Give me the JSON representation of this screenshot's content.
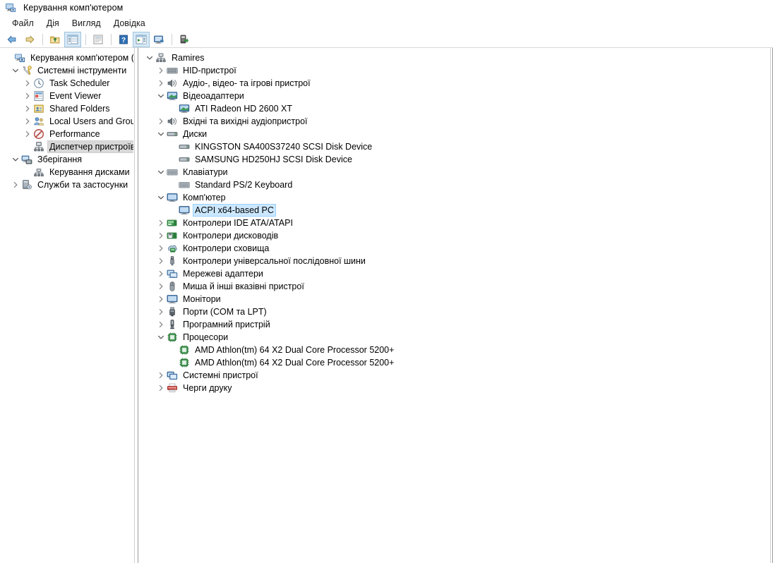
{
  "window": {
    "title": "Керування комп'ютером",
    "icon": "computer-management-icon"
  },
  "menubar": {
    "items": [
      {
        "label": "Файл",
        "name": "menu-file"
      },
      {
        "label": "Дія",
        "name": "menu-action"
      },
      {
        "label": "Вигляд",
        "name": "menu-view"
      },
      {
        "label": "Довідка",
        "name": "menu-help"
      }
    ]
  },
  "toolbar": {
    "buttons": [
      {
        "name": "back-button",
        "icon": "arrow-left-icon",
        "pressed": false
      },
      {
        "name": "forward-button",
        "icon": "arrow-right-icon",
        "pressed": false
      },
      {
        "name": "up-one-level-button",
        "icon": "folder-up-icon",
        "pressed": false
      },
      {
        "name": "show-hide-console-tree-button",
        "icon": "console-tree-icon",
        "pressed": true
      },
      {
        "name": "properties-button",
        "icon": "properties-icon",
        "pressed": false
      },
      {
        "name": "help-button",
        "icon": "question-mark-icon",
        "pressed": false
      },
      {
        "name": "show-hide-action-pane-button",
        "icon": "action-pane-icon",
        "pressed": true
      },
      {
        "name": "scan-for-hardware-changes-button",
        "icon": "monitor-scan-icon",
        "pressed": false
      },
      {
        "name": "add-legacy-hardware-button",
        "icon": "add-hardware-icon",
        "pressed": false
      }
    ]
  },
  "left_tree": {
    "nodes": [
      {
        "label": "Керування комп'ютером (лок",
        "indent": 0,
        "twist": "none",
        "icon": "computer-management-icon",
        "selected": "none"
      },
      {
        "label": "Системні інструменти",
        "indent": 1,
        "twist": "expanded",
        "icon": "system-tools-icon",
        "selected": "none"
      },
      {
        "label": "Task Scheduler",
        "indent": 2,
        "twist": "collapsed",
        "icon": "clock-icon",
        "selected": "none"
      },
      {
        "label": "Event Viewer",
        "indent": 2,
        "twist": "collapsed",
        "icon": "event-viewer-icon",
        "selected": "none"
      },
      {
        "label": "Shared Folders",
        "indent": 2,
        "twist": "collapsed",
        "icon": "shared-folders-icon",
        "selected": "none"
      },
      {
        "label": "Local Users and Groups",
        "indent": 2,
        "twist": "collapsed",
        "icon": "users-groups-icon",
        "selected": "none"
      },
      {
        "label": "Performance",
        "indent": 2,
        "twist": "collapsed",
        "icon": "performance-icon",
        "selected": "none"
      },
      {
        "label": "Диспетчер пристроїв",
        "indent": 2,
        "twist": "none",
        "icon": "device-manager-icon",
        "selected": "inactive"
      },
      {
        "label": "Зберігання",
        "indent": 1,
        "twist": "expanded",
        "icon": "storage-icon",
        "selected": "none"
      },
      {
        "label": "Керування дисками",
        "indent": 2,
        "twist": "none",
        "icon": "disk-management-icon",
        "selected": "none"
      },
      {
        "label": "Служби та застосунки",
        "indent": 1,
        "twist": "collapsed",
        "icon": "services-apps-icon",
        "selected": "none"
      }
    ]
  },
  "device_tree": {
    "nodes": [
      {
        "label": "Ramires",
        "indent": 0,
        "twist": "expanded",
        "icon": "computer-node-icon",
        "selected": "none"
      },
      {
        "label": "HID-пристрої",
        "indent": 1,
        "twist": "collapsed",
        "icon": "hid-icon",
        "selected": "none"
      },
      {
        "label": "Аудіо-, відео- та ігрові пристрої",
        "indent": 1,
        "twist": "collapsed",
        "icon": "speaker-icon",
        "selected": "none"
      },
      {
        "label": "Відеоадаптери",
        "indent": 1,
        "twist": "expanded",
        "icon": "display-adapter-icon",
        "selected": "none"
      },
      {
        "label": "ATI Radeon HD 2600 XT",
        "indent": 2,
        "twist": "none",
        "icon": "display-adapter-icon",
        "selected": "none"
      },
      {
        "label": "Вхідні та вихідні аудіопристрої",
        "indent": 1,
        "twist": "collapsed",
        "icon": "speaker-icon",
        "selected": "none"
      },
      {
        "label": "Диски",
        "indent": 1,
        "twist": "expanded",
        "icon": "disk-drive-icon",
        "selected": "none"
      },
      {
        "label": "KINGSTON  SA400S37240 SCSI Disk Device",
        "indent": 2,
        "twist": "none",
        "icon": "disk-drive-icon",
        "selected": "none"
      },
      {
        "label": "SAMSUNG HD250HJ SCSI Disk Device",
        "indent": 2,
        "twist": "none",
        "icon": "disk-drive-icon",
        "selected": "none"
      },
      {
        "label": "Клавіатури",
        "indent": 1,
        "twist": "expanded",
        "icon": "keyboard-icon",
        "selected": "none"
      },
      {
        "label": "Standard PS/2 Keyboard",
        "indent": 2,
        "twist": "none",
        "icon": "keyboard-icon",
        "selected": "none"
      },
      {
        "label": "Комп'ютер",
        "indent": 1,
        "twist": "expanded",
        "icon": "monitor-icon",
        "selected": "none"
      },
      {
        "label": "ACPI x64-based PC",
        "indent": 2,
        "twist": "none",
        "icon": "monitor-icon",
        "selected": "active"
      },
      {
        "label": "Контролери IDE ATA/ATAPI",
        "indent": 1,
        "twist": "collapsed",
        "icon": "ide-controller-icon",
        "selected": "none"
      },
      {
        "label": "Контролери дисководів",
        "indent": 1,
        "twist": "collapsed",
        "icon": "floppy-controller-icon",
        "selected": "none"
      },
      {
        "label": "Контролери сховища",
        "indent": 1,
        "twist": "collapsed",
        "icon": "storage-controller-icon",
        "selected": "none"
      },
      {
        "label": "Контролери універсальної послідовної шини",
        "indent": 1,
        "twist": "collapsed",
        "icon": "usb-icon",
        "selected": "none"
      },
      {
        "label": "Мережеві адаптери",
        "indent": 1,
        "twist": "collapsed",
        "icon": "network-adapter-icon",
        "selected": "none"
      },
      {
        "label": "Миша й інші вказівні пристрої",
        "indent": 1,
        "twist": "collapsed",
        "icon": "mouse-icon",
        "selected": "none"
      },
      {
        "label": "Монітори",
        "indent": 1,
        "twist": "collapsed",
        "icon": "monitor-icon",
        "selected": "none"
      },
      {
        "label": "Порти (COM та LPT)",
        "indent": 1,
        "twist": "collapsed",
        "icon": "port-icon",
        "selected": "none"
      },
      {
        "label": "Програмний пристрій",
        "indent": 1,
        "twist": "collapsed",
        "icon": "software-device-icon",
        "selected": "none"
      },
      {
        "label": "Процесори",
        "indent": 1,
        "twist": "expanded",
        "icon": "processor-icon",
        "selected": "none"
      },
      {
        "label": "AMD Athlon(tm) 64 X2 Dual Core Processor 5200+",
        "indent": 2,
        "twist": "none",
        "icon": "processor-icon",
        "selected": "none"
      },
      {
        "label": "AMD Athlon(tm) 64 X2 Dual Core Processor 5200+",
        "indent": 2,
        "twist": "none",
        "icon": "processor-icon",
        "selected": "none"
      },
      {
        "label": "Системні пристрої",
        "indent": 1,
        "twist": "collapsed",
        "icon": "system-device-icon",
        "selected": "none"
      },
      {
        "label": "Черги друку",
        "indent": 1,
        "twist": "collapsed",
        "icon": "printer-icon",
        "selected": "none"
      }
    ]
  },
  "colors": {
    "selection_active": "#cce8ff",
    "selection_inactive": "#d9d9d9",
    "window_bg": "#ffffff",
    "text": "#000000",
    "toolbar_pressed": "#d7e9f7"
  }
}
